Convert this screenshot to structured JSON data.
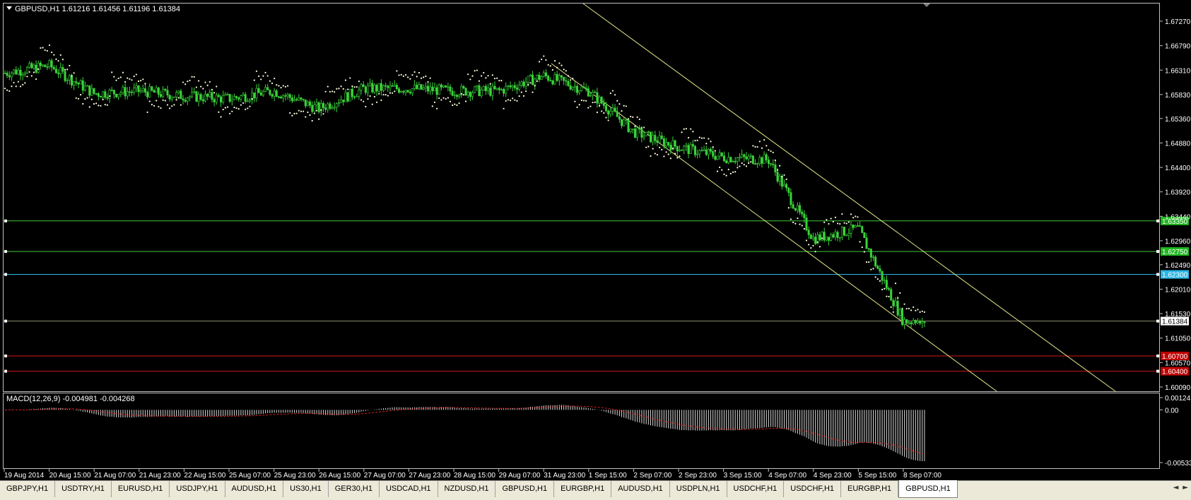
{
  "window": {
    "symbol_header": "GBPUSD,H1  1.61216 1.61456 1.61196 1.61384",
    "collapse_icon": "triangle-down-icon"
  },
  "price_axis": {
    "ticks": [
      "1.67270",
      "1.66790",
      "1.66310",
      "1.65830",
      "1.65360",
      "1.64880",
      "1.64400",
      "1.63920",
      "1.63440",
      "1.62960",
      "1.62490",
      "1.62010",
      "1.61530",
      "1.61050",
      "1.60570",
      "1.60090"
    ]
  },
  "levels": [
    {
      "name": "green-upper",
      "value": 1.6335,
      "label": "1.63350",
      "color": "#3ec93e",
      "label_bg": "#1fb81f"
    },
    {
      "name": "green-lower",
      "value": 1.6275,
      "label": "1.62750",
      "color": "#3ec93e",
      "label_bg": "#1fb81f"
    },
    {
      "name": "cyan",
      "value": 1.623,
      "label": "1.62300",
      "color": "#2bb6e6",
      "label_bg": "#2bb6e6"
    },
    {
      "name": "current-price",
      "value": 1.61384,
      "label": "1.61384",
      "color": "#8a8a70",
      "label_bg": "#ffffff"
    },
    {
      "name": "red-upper",
      "value": 1.607,
      "label": "1.60700",
      "color": "#d01818",
      "label_bg": "#c00000"
    },
    {
      "name": "red-lower",
      "value": 1.604,
      "label": "1.60400",
      "color": "#d01818",
      "label_bg": "#c00000"
    }
  ],
  "macd": {
    "header": "MACD(12,26,9) -0.004981 -0.004268",
    "ticks": [
      "0.00124",
      "0.00",
      "-0.005335"
    ]
  },
  "time_axis": {
    "labels": [
      "19 Aug 2014",
      "20 Aug 15:00",
      "21 Aug 07:00",
      "21 Aug 23:00",
      "22 Aug 15:00",
      "25 Aug 07:00",
      "25 Aug 23:00",
      "26 Aug 15:00",
      "27 Aug 07:00",
      "27 Aug 23:00",
      "28 Aug 15:00",
      "29 Aug 07:00",
      "31 Aug 23:00",
      "1 Sep 15:00",
      "2 Sep 07:00",
      "2 Sep 23:00",
      "3 Sep 15:00",
      "4 Sep 07:00",
      "4 Sep 23:00",
      "5 Sep 15:00",
      "8 Sep 07:00"
    ]
  },
  "tabs": [
    {
      "label": "GBPJPY,H1",
      "active": false
    },
    {
      "label": "USDTRY,H1",
      "active": false
    },
    {
      "label": "EURUSD,H1",
      "active": false
    },
    {
      "label": "USDJPY,H1",
      "active": false
    },
    {
      "label": "AUDUSD,H1",
      "active": false
    },
    {
      "label": "US30,H1",
      "active": false
    },
    {
      "label": "GER30,H1",
      "active": false
    },
    {
      "label": "USDCAD,H1",
      "active": false
    },
    {
      "label": "NZDUSD,H1",
      "active": false
    },
    {
      "label": "GBPUSD,H1",
      "active": false
    },
    {
      "label": "EURGBP,H1",
      "active": false
    },
    {
      "label": "AUDUSD,H1",
      "active": false
    },
    {
      "label": "USDPLN,H1",
      "active": false
    },
    {
      "label": "USDCHF,H1",
      "active": false
    },
    {
      "label": "USDCHF,H1",
      "active": false
    },
    {
      "label": "EURGBP,H1",
      "active": false
    },
    {
      "label": "GBPUSD,H1",
      "active": true
    }
  ],
  "tab_scroll": {
    "left": "◄",
    "right": "►"
  },
  "chart_data": {
    "type": "candlestick",
    "symbol": "GBPUSD",
    "timeframe": "H1",
    "ylim": [
      1.6009,
      1.6727
    ],
    "path_anchors": [
      {
        "t": "19 Aug 2014",
        "p": 1.6625
      },
      {
        "t": "20 Aug 15:00",
        "p": 1.664
      },
      {
        "t": "21 Aug 07:00",
        "p": 1.6585
      },
      {
        "t": "21 Aug 23:00",
        "p": 1.659
      },
      {
        "t": "22 Aug 15:00",
        "p": 1.658
      },
      {
        "t": "25 Aug 07:00",
        "p": 1.6575
      },
      {
        "t": "25 Aug 23:00",
        "p": 1.659
      },
      {
        "t": "26 Aug 15:00",
        "p": 1.6555
      },
      {
        "t": "27 Aug 07:00",
        "p": 1.6595
      },
      {
        "t": "27 Aug 23:00",
        "p": 1.6595
      },
      {
        "t": "28 Aug 15:00",
        "p": 1.659
      },
      {
        "t": "29 Aug 07:00",
        "p": 1.659
      },
      {
        "t": "31 Aug 23:00",
        "p": 1.662
      },
      {
        "t": "1 Sep 15:00",
        "p": 1.659
      },
      {
        "t": "2 Sep 07:00",
        "p": 1.651
      },
      {
        "t": "2 Sep 23:00",
        "p": 1.648
      },
      {
        "t": "3 Sep 15:00",
        "p": 1.646
      },
      {
        "t": "4 Sep 07:00",
        "p": 1.6455
      },
      {
        "t": "4 Sep 23:00",
        "p": 1.63
      },
      {
        "t": "5 Sep 15:00",
        "p": 1.632
      },
      {
        "t": "8 Sep 07:00",
        "p": 1.6138
      }
    ],
    "last_ohlc": {
      "open": 1.61216,
      "high": 1.61456,
      "low": 1.61196,
      "close": 1.61384
    },
    "indicators": [
      "Parabolic SAR",
      "MACD(12,26,9)",
      "Descending channel"
    ]
  }
}
